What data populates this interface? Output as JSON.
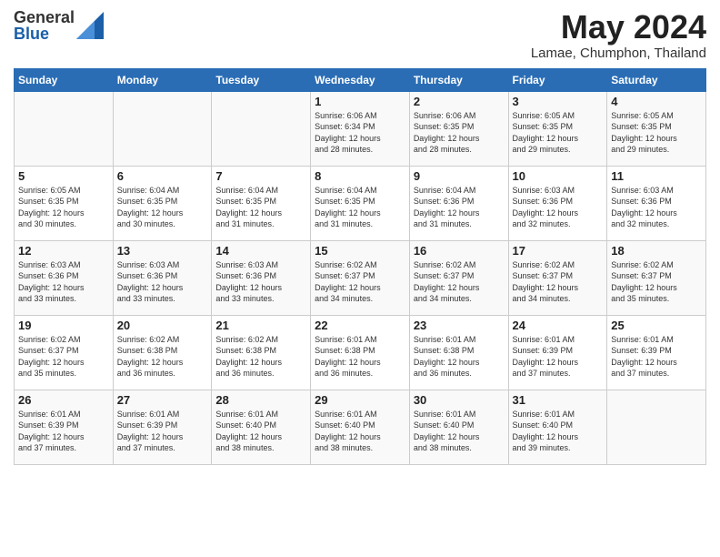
{
  "app": {
    "logo_general": "General",
    "logo_blue": "Blue",
    "month_title": "May 2024",
    "subtitle": "Lamae, Chumphon, Thailand"
  },
  "calendar": {
    "days_of_week": [
      "Sunday",
      "Monday",
      "Tuesday",
      "Wednesday",
      "Thursday",
      "Friday",
      "Saturday"
    ],
    "weeks": [
      [
        {
          "num": "",
          "info": ""
        },
        {
          "num": "",
          "info": ""
        },
        {
          "num": "",
          "info": ""
        },
        {
          "num": "1",
          "info": "Sunrise: 6:06 AM\nSunset: 6:34 PM\nDaylight: 12 hours\nand 28 minutes."
        },
        {
          "num": "2",
          "info": "Sunrise: 6:06 AM\nSunset: 6:35 PM\nDaylight: 12 hours\nand 28 minutes."
        },
        {
          "num": "3",
          "info": "Sunrise: 6:05 AM\nSunset: 6:35 PM\nDaylight: 12 hours\nand 29 minutes."
        },
        {
          "num": "4",
          "info": "Sunrise: 6:05 AM\nSunset: 6:35 PM\nDaylight: 12 hours\nand 29 minutes."
        }
      ],
      [
        {
          "num": "5",
          "info": "Sunrise: 6:05 AM\nSunset: 6:35 PM\nDaylight: 12 hours\nand 30 minutes."
        },
        {
          "num": "6",
          "info": "Sunrise: 6:04 AM\nSunset: 6:35 PM\nDaylight: 12 hours\nand 30 minutes."
        },
        {
          "num": "7",
          "info": "Sunrise: 6:04 AM\nSunset: 6:35 PM\nDaylight: 12 hours\nand 31 minutes."
        },
        {
          "num": "8",
          "info": "Sunrise: 6:04 AM\nSunset: 6:35 PM\nDaylight: 12 hours\nand 31 minutes."
        },
        {
          "num": "9",
          "info": "Sunrise: 6:04 AM\nSunset: 6:36 PM\nDaylight: 12 hours\nand 31 minutes."
        },
        {
          "num": "10",
          "info": "Sunrise: 6:03 AM\nSunset: 6:36 PM\nDaylight: 12 hours\nand 32 minutes."
        },
        {
          "num": "11",
          "info": "Sunrise: 6:03 AM\nSunset: 6:36 PM\nDaylight: 12 hours\nand 32 minutes."
        }
      ],
      [
        {
          "num": "12",
          "info": "Sunrise: 6:03 AM\nSunset: 6:36 PM\nDaylight: 12 hours\nand 33 minutes."
        },
        {
          "num": "13",
          "info": "Sunrise: 6:03 AM\nSunset: 6:36 PM\nDaylight: 12 hours\nand 33 minutes."
        },
        {
          "num": "14",
          "info": "Sunrise: 6:03 AM\nSunset: 6:36 PM\nDaylight: 12 hours\nand 33 minutes."
        },
        {
          "num": "15",
          "info": "Sunrise: 6:02 AM\nSunset: 6:37 PM\nDaylight: 12 hours\nand 34 minutes."
        },
        {
          "num": "16",
          "info": "Sunrise: 6:02 AM\nSunset: 6:37 PM\nDaylight: 12 hours\nand 34 minutes."
        },
        {
          "num": "17",
          "info": "Sunrise: 6:02 AM\nSunset: 6:37 PM\nDaylight: 12 hours\nand 34 minutes."
        },
        {
          "num": "18",
          "info": "Sunrise: 6:02 AM\nSunset: 6:37 PM\nDaylight: 12 hours\nand 35 minutes."
        }
      ],
      [
        {
          "num": "19",
          "info": "Sunrise: 6:02 AM\nSunset: 6:37 PM\nDaylight: 12 hours\nand 35 minutes."
        },
        {
          "num": "20",
          "info": "Sunrise: 6:02 AM\nSunset: 6:38 PM\nDaylight: 12 hours\nand 36 minutes."
        },
        {
          "num": "21",
          "info": "Sunrise: 6:02 AM\nSunset: 6:38 PM\nDaylight: 12 hours\nand 36 minutes."
        },
        {
          "num": "22",
          "info": "Sunrise: 6:01 AM\nSunset: 6:38 PM\nDaylight: 12 hours\nand 36 minutes."
        },
        {
          "num": "23",
          "info": "Sunrise: 6:01 AM\nSunset: 6:38 PM\nDaylight: 12 hours\nand 36 minutes."
        },
        {
          "num": "24",
          "info": "Sunrise: 6:01 AM\nSunset: 6:39 PM\nDaylight: 12 hours\nand 37 minutes."
        },
        {
          "num": "25",
          "info": "Sunrise: 6:01 AM\nSunset: 6:39 PM\nDaylight: 12 hours\nand 37 minutes."
        }
      ],
      [
        {
          "num": "26",
          "info": "Sunrise: 6:01 AM\nSunset: 6:39 PM\nDaylight: 12 hours\nand 37 minutes."
        },
        {
          "num": "27",
          "info": "Sunrise: 6:01 AM\nSunset: 6:39 PM\nDaylight: 12 hours\nand 37 minutes."
        },
        {
          "num": "28",
          "info": "Sunrise: 6:01 AM\nSunset: 6:40 PM\nDaylight: 12 hours\nand 38 minutes."
        },
        {
          "num": "29",
          "info": "Sunrise: 6:01 AM\nSunset: 6:40 PM\nDaylight: 12 hours\nand 38 minutes."
        },
        {
          "num": "30",
          "info": "Sunrise: 6:01 AM\nSunset: 6:40 PM\nDaylight: 12 hours\nand 38 minutes."
        },
        {
          "num": "31",
          "info": "Sunrise: 6:01 AM\nSunset: 6:40 PM\nDaylight: 12 hours\nand 39 minutes."
        },
        {
          "num": "",
          "info": ""
        }
      ]
    ]
  }
}
